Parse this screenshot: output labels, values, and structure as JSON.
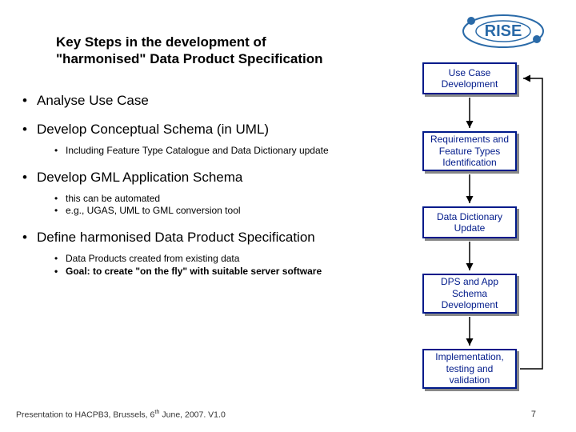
{
  "logo": {
    "text": "RISE"
  },
  "title": "Key Steps in the development of \"harmonised\" Data Product Specification",
  "bullets": {
    "b1": "Analyse Use Case",
    "b2": "Develop Conceptual Schema (in UML)",
    "b2_1": "Including Feature Type Catalogue and Data Dictionary update",
    "b3": "Develop GML Application Schema",
    "b3_1": "this can be automated",
    "b3_2": "e.g., UGAS, UML to GML conversion tool",
    "b4": "Define harmonised Data Product Specification",
    "b4_1": "Data Products created from existing data",
    "b4_2_prefix": "Goal: to create \"on the fly\" with suitable server software"
  },
  "boxes": {
    "bx1": "Use Case Development",
    "bx2": "Requirements and Feature Types Identification",
    "bx3": "Data Dictionary Update",
    "bx4": "DPS and App Schema Development",
    "bx5": "Implementation, testing and validation"
  },
  "footer": {
    "left_a": "Presentation to HACPB3, Brussels, 6",
    "left_sup": "th",
    "left_b": " June, 2007. V1.0",
    "page": "7"
  },
  "colors": {
    "accent": "#001a8a"
  }
}
